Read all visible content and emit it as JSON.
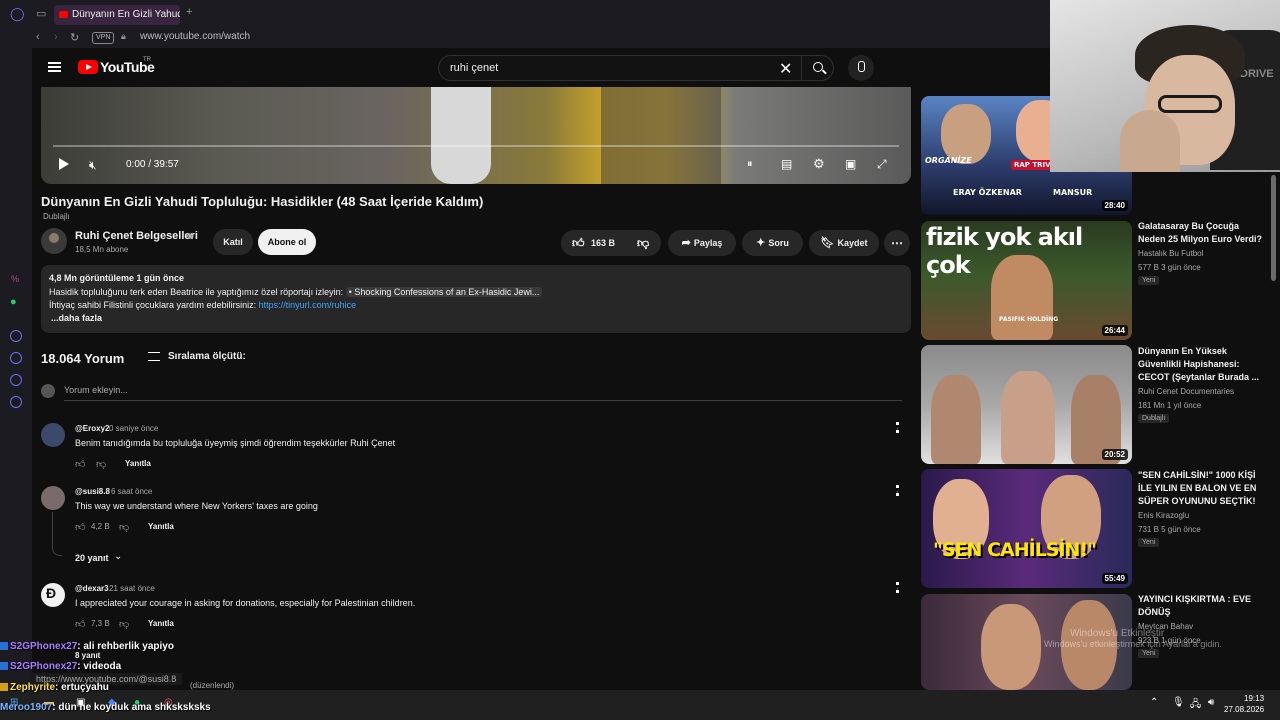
{
  "browser": {
    "tab_title": "Dünyanın En Gizli Yahudi Topluluğu",
    "vpn": "VPN",
    "url": "www.youtube.com/watch",
    "new_tab": "+"
  },
  "header": {
    "logo": "YouTube",
    "logo_region": "TR",
    "search_value": "ruhi çenet",
    "clear_glyph": "✕"
  },
  "player": {
    "time": "0:00 / 39:57"
  },
  "video": {
    "title": "Dünyanın En Gizli Yahudi Topluluğu: Hasidikler (48 Saat İçeride Kaldım)",
    "dubbed": "Dublajlı",
    "channel": "Ruhi Çenet Belgeselleri",
    "subscribers": "18,5 Mn abone",
    "join": "Katıl",
    "subscribe": "Abone ol",
    "likes": "163 B",
    "share": "Paylaş",
    "ask": "Soru",
    "save": "Kaydet"
  },
  "description": {
    "stats": "4,8 Mn görüntüleme  1 gün önce",
    "line1": "Hasidik topluluğunu terk eden Beatrice ile yaptığımız özel röportajı izleyin:",
    "line1_link": "• Shocking Confessions of an Ex-Hasidic Jewi...",
    "line2": "İhtiyaç sahibi Filistinli çocuklara yardım edebilirsiniz:",
    "line2_link": "https://tinyurl.com/ruhice",
    "more": "...daha fazla"
  },
  "comments": {
    "count": "18.064 Yorum",
    "sort": "Sıralama ölçütü:",
    "add_placeholder": "Yorum ekleyin...",
    "reply_label": "Yanıtla",
    "items": [
      {
        "author": "@Eroxy2",
        "time": "0 saniye önce",
        "text": "Benim tanıdığımda bu topluluğa üyeymiş şimdi öğrendim teşekkürler Ruhi Çenet",
        "likes": ""
      },
      {
        "author": "@susi8.8",
        "time": "6 saat önce",
        "text": "This way we understand where New Yorkers' taxes are going",
        "likes": "4,2 B",
        "replies": "20 yanıt"
      },
      {
        "author": "@dexar3",
        "time": "21 saat önce",
        "text": "I appreciated your courage in asking for donations, especially for Palestinian children.",
        "likes": "7,3 B",
        "replies": "8 yanıt"
      }
    ],
    "edited": "(düzenlendi)"
  },
  "recommended": [
    {
      "title": "",
      "channel": "",
      "meta": "",
      "duration": "28:40",
      "thumb_words": [
        "ORGANİZE",
        "ERAY ÖZKENAR",
        "MANSUR",
        "RAP TRIVIA"
      ]
    },
    {
      "title": "Galatasaray Bu Çocuğa Neden 25 Milyon Euro Verdi?",
      "channel": "Hastalık Bu Futbol",
      "meta": "577 B  3 gün önce",
      "badge": "Yeni",
      "duration": "26:44",
      "thumb_words": [
        "fizik yok akıl çok",
        "PASIFIK HOLDİNG"
      ]
    },
    {
      "title": "Dünyanın En Yüksek Güvenlikli Hapishanesi: CECOT (Şeytanlar Burada ...",
      "channel": "Ruhi Cenet Documentaries",
      "meta": "181 Mn  1 yıl önce",
      "badge": "Dublajlı",
      "duration": "20:52"
    },
    {
      "title": "\"SEN CAHİLSİN!\" 1000 KİŞİ İLE YILIN EN BALON VE EN SÜPER OYUNUNU SEÇTİK!",
      "channel": "Enis Kirazoglu",
      "meta": "731 B  5 gün önce",
      "badge": "Yeni",
      "duration": "55:49",
      "thumb_words": [
        "\"SEN CAHİLSİN!\""
      ]
    },
    {
      "title": "YAYINCI KIŞKIRTMA : EVE DÖNÜŞ",
      "channel": "Meytcan Bahav",
      "meta": "923 B  1 gün önce",
      "badge": "Yeni",
      "duration": ""
    }
  ],
  "webcam": {
    "brand": "DRIVE"
  },
  "activation": {
    "line1": "Windows'u Etkinleştir",
    "line2": "Windows'u etkinleştirmek için Ayarlar'a gidin."
  },
  "chat": [
    {
      "user": "S2GPhonex27",
      "msg": ": ali rehberlik yapiyo"
    },
    {
      "user": "S2GPhonex27",
      "msg": ": videoda"
    },
    {
      "user": "Zephyrite",
      "msg": ": ertuçyahu"
    },
    {
      "user": "Meroo1907",
      "msg": ": dün ne koyduk ama shksksksks"
    }
  ],
  "status_url": "https://www.youtube.com/@susi8.8",
  "clock": {
    "time": "19:13",
    "date": "27.08.2026"
  },
  "colors": {
    "accent": "#ff0000",
    "link": "#3ea6ff",
    "bg": "#0f0f0f"
  }
}
